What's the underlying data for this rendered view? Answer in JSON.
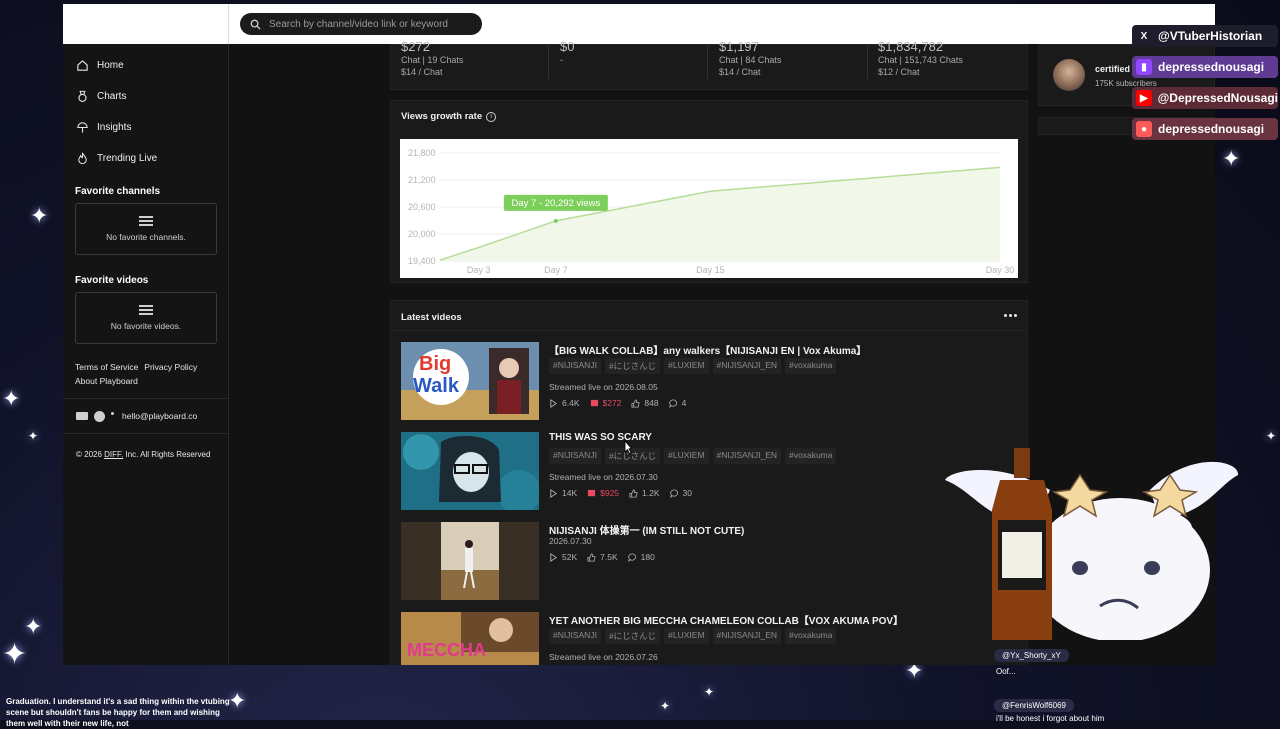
{
  "search": {
    "placeholder": "Search by channel/video link or keyword"
  },
  "sidebar": {
    "items": [
      {
        "label": "Home",
        "icon": "home-icon"
      },
      {
        "label": "Charts",
        "icon": "medal-icon"
      },
      {
        "label": "Insights",
        "icon": "insights-icon"
      },
      {
        "label": "Trending Live",
        "icon": "flame-icon"
      }
    ],
    "favorite_channels": {
      "heading": "Favorite channels",
      "empty": "No favorite channels."
    },
    "favorite_videos": {
      "heading": "Favorite videos",
      "empty": "No favorite videos."
    },
    "links": {
      "terms": "Terms of Service",
      "privacy": "Privacy Policy",
      "about": "About Playboard"
    },
    "email": "hello@playboard.co",
    "copyright_prefix": "© 2026",
    "copyright_company": "DIFF.",
    "copyright_suffix": "Inc. All Rights Reserved"
  },
  "stats": [
    {
      "big": "$272",
      "line1": "Chat | 19 Chats",
      "line2": "$14 / Chat"
    },
    {
      "big": "$0",
      "line1": "-",
      "line2": ""
    },
    {
      "big": "$1,197",
      "line1": "Chat | 84 Chats",
      "line2": "$14 / Chat"
    },
    {
      "big": "$1,834,782",
      "line1": "Chat | 151,743 Chats",
      "line2": "$12 / Chat"
    }
  ],
  "growth": {
    "title": "Views growth rate",
    "tooltip": "Day 7 - 20,292 views",
    "info_icon": "info-icon"
  },
  "chart_data": {
    "type": "area",
    "title": "Views growth rate",
    "x_tick_labels": [
      "Day 3",
      "Day 7",
      "Day 15",
      "Day 30"
    ],
    "y_tick_labels": [
      "19,400",
      "20,000",
      "20,600",
      "21,200",
      "21,800"
    ],
    "ylim": [
      19400,
      21800
    ],
    "series": [
      {
        "x": [
          1,
          3,
          7,
          15,
          30
        ],
        "values": [
          19420,
          19700,
          20292,
          20950,
          21480
        ]
      }
    ],
    "colors": {
      "line": "#b6dd9a",
      "fill": "#f1f8ea",
      "tooltip": "#7ccf5a"
    },
    "grid": true
  },
  "latest": {
    "title": "Latest videos",
    "videos": [
      {
        "title": "【BIG WALK COLLAB】any walkers【NIJISANJI EN | Vox Akuma】",
        "tags": [
          "#NIJISANJI",
          "#にじさんじ",
          "#LUXIEM",
          "#NIJISANJI_EN",
          "#voxakuma"
        ],
        "date": "Streamed live on 2026.08.05",
        "views": "6.4K",
        "money": "$272",
        "likes": "848",
        "comments": "4",
        "thumb": "big-walk"
      },
      {
        "title": "THIS WAS SO SCARY",
        "tags": [
          "#NIJISANJI",
          "#にじさんじ",
          "#LUXIEM",
          "#NIJISANJI_EN",
          "#voxakuma"
        ],
        "date": "Streamed live on 2026.07.30",
        "views": "14K",
        "money": "$925",
        "likes": "1.2K",
        "comments": "30",
        "thumb": "scary"
      },
      {
        "title": "NIJISANJI 体操第一 (IM STILL NOT CUTE)",
        "tags": [],
        "date": "2026.07.30",
        "views": "52K",
        "money": "",
        "likes": "7.5K",
        "comments": "180",
        "thumb": "dance"
      },
      {
        "title": "YET ANOTHER BIG MECCHA CHAMELEON COLLAB【VOX AKUMA POV】",
        "tags": [
          "#NIJISANJI",
          "#にじさんじ",
          "#LUXIEM",
          "#NIJISANJI_EN",
          "#voxakuma"
        ],
        "date": "Streamed live on 2026.07.26",
        "views": "",
        "money": "",
        "likes": "",
        "comments": "",
        "thumb": "meccha"
      }
    ]
  },
  "right_panel": {
    "name": "certified",
    "subs": "175K subscribers"
  },
  "overlay": {
    "socials": [
      {
        "label": "@VTuberHistorian",
        "icon": "x-icon"
      },
      {
        "label": "depressednousagi",
        "icon": "twitch-icon"
      },
      {
        "label": "@DepressedNousagi",
        "icon": "youtube-icon"
      },
      {
        "label": "depressednousagi",
        "icon": "kick-icon"
      }
    ],
    "chat": [
      {
        "user": "@Yx_Shorty_xY",
        "message": "Oof..."
      },
      {
        "user": "@FenrisWolf6069",
        "message": "i'll be honest i forgot about him"
      }
    ],
    "ticker": "Graduation. I understand it's a sad thing within the vtubing scene but shouldn't fans be happy for them and wishing them well with their new life, not"
  }
}
